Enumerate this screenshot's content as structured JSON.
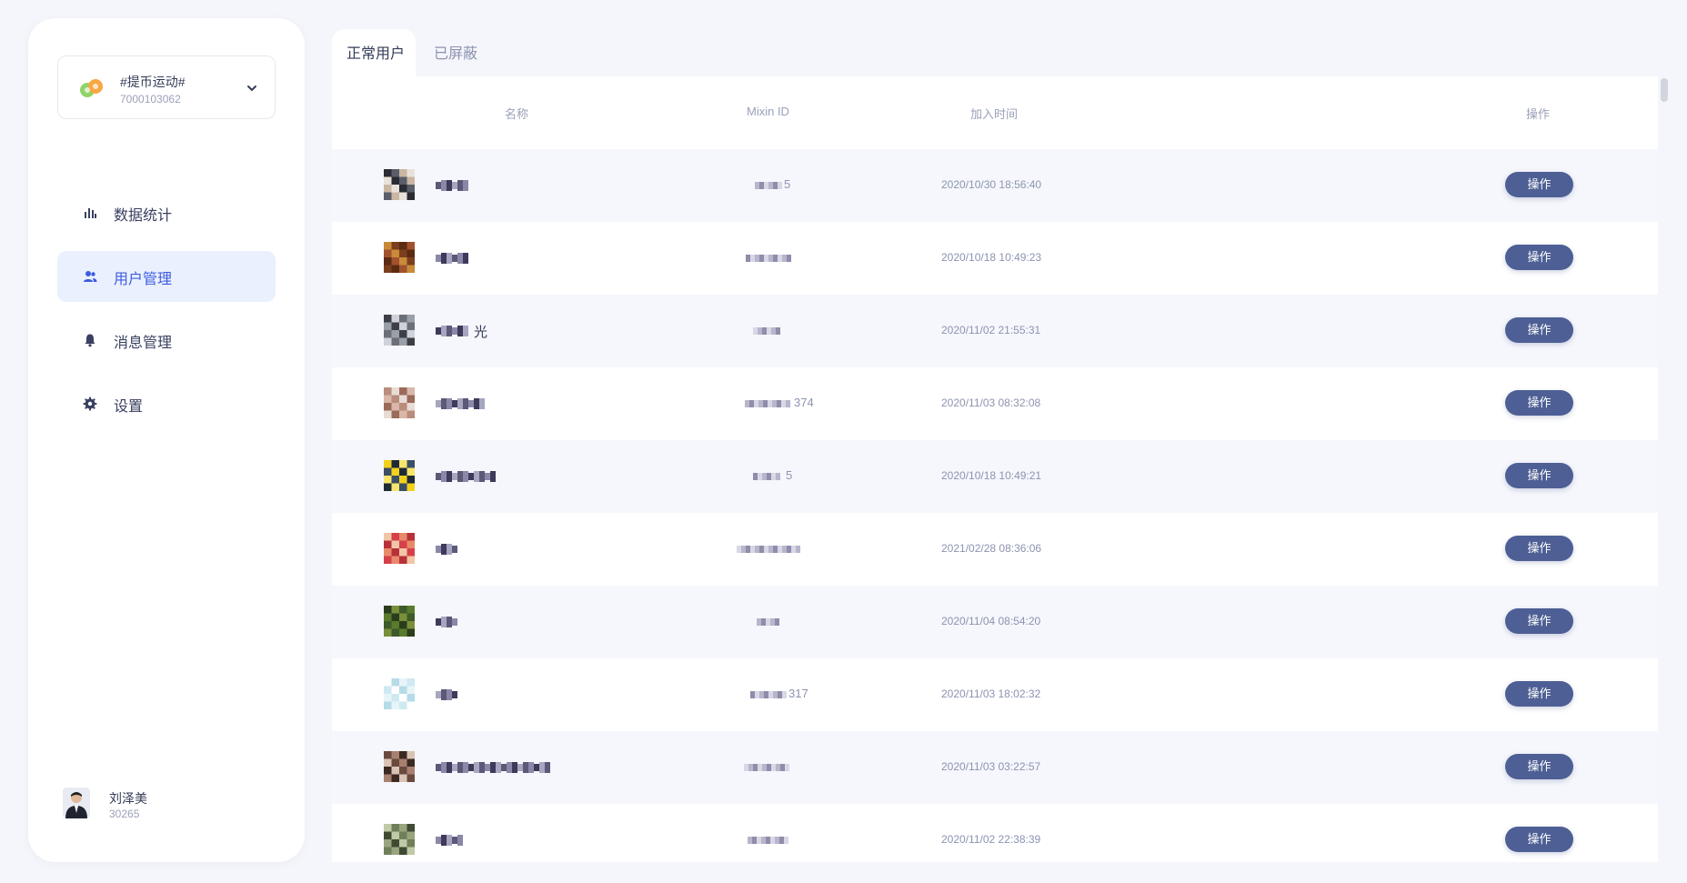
{
  "group": {
    "name": "#提币运动#",
    "id": "7000103062",
    "icon": "group-icon"
  },
  "nav": {
    "items": [
      {
        "label": "数据统计",
        "icon": "bar-chart-icon"
      },
      {
        "label": "用户管理",
        "icon": "users-icon",
        "active": true
      },
      {
        "label": "消息管理",
        "icon": "bell-icon"
      },
      {
        "label": "设置",
        "icon": "gear-icon"
      }
    ]
  },
  "current_user": {
    "name": "刘泽美",
    "id": "30265"
  },
  "tabs": [
    {
      "label": "正常用户",
      "active": true
    },
    {
      "label": "已屏蔽",
      "active": false
    }
  ],
  "table": {
    "columns": [
      "名称",
      "Mixin ID",
      "加入时间",
      "操作"
    ],
    "action_label": "操作",
    "rows": [
      {
        "name_visible": "",
        "mixin_visible": "5",
        "joined": "2020/10/30 18:56:40"
      },
      {
        "name_visible": "",
        "mixin_visible": "",
        "joined": "2020/10/18 10:49:23"
      },
      {
        "name_visible": "光",
        "mixin_visible": "",
        "joined": "2020/11/02 21:55:31"
      },
      {
        "name_visible": "",
        "mixin_visible": "374",
        "joined": "2020/11/03 08:32:08"
      },
      {
        "name_visible": "",
        "mixin_visible": "5",
        "joined": "2020/10/18 10:49:21"
      },
      {
        "name_visible": "",
        "mixin_visible": "",
        "joined": "2021/02/28 08:36:06"
      },
      {
        "name_visible": "",
        "mixin_visible": "",
        "joined": "2020/11/04 08:54:20"
      },
      {
        "name_visible": "",
        "mixin_visible": "317",
        "joined": "2020/11/03 18:02:32"
      },
      {
        "name_visible": "",
        "mixin_visible": "",
        "joined": "2020/11/03 03:22:57"
      },
      {
        "name_visible": "",
        "mixin_visible": "",
        "joined": "2020/11/02 22:38:39"
      }
    ]
  },
  "colors": {
    "accent": "#3d5ce0",
    "active_nav_bg": "#eaf0fe",
    "button": "#4d5f94",
    "page_bg": "#f5f6fb"
  }
}
